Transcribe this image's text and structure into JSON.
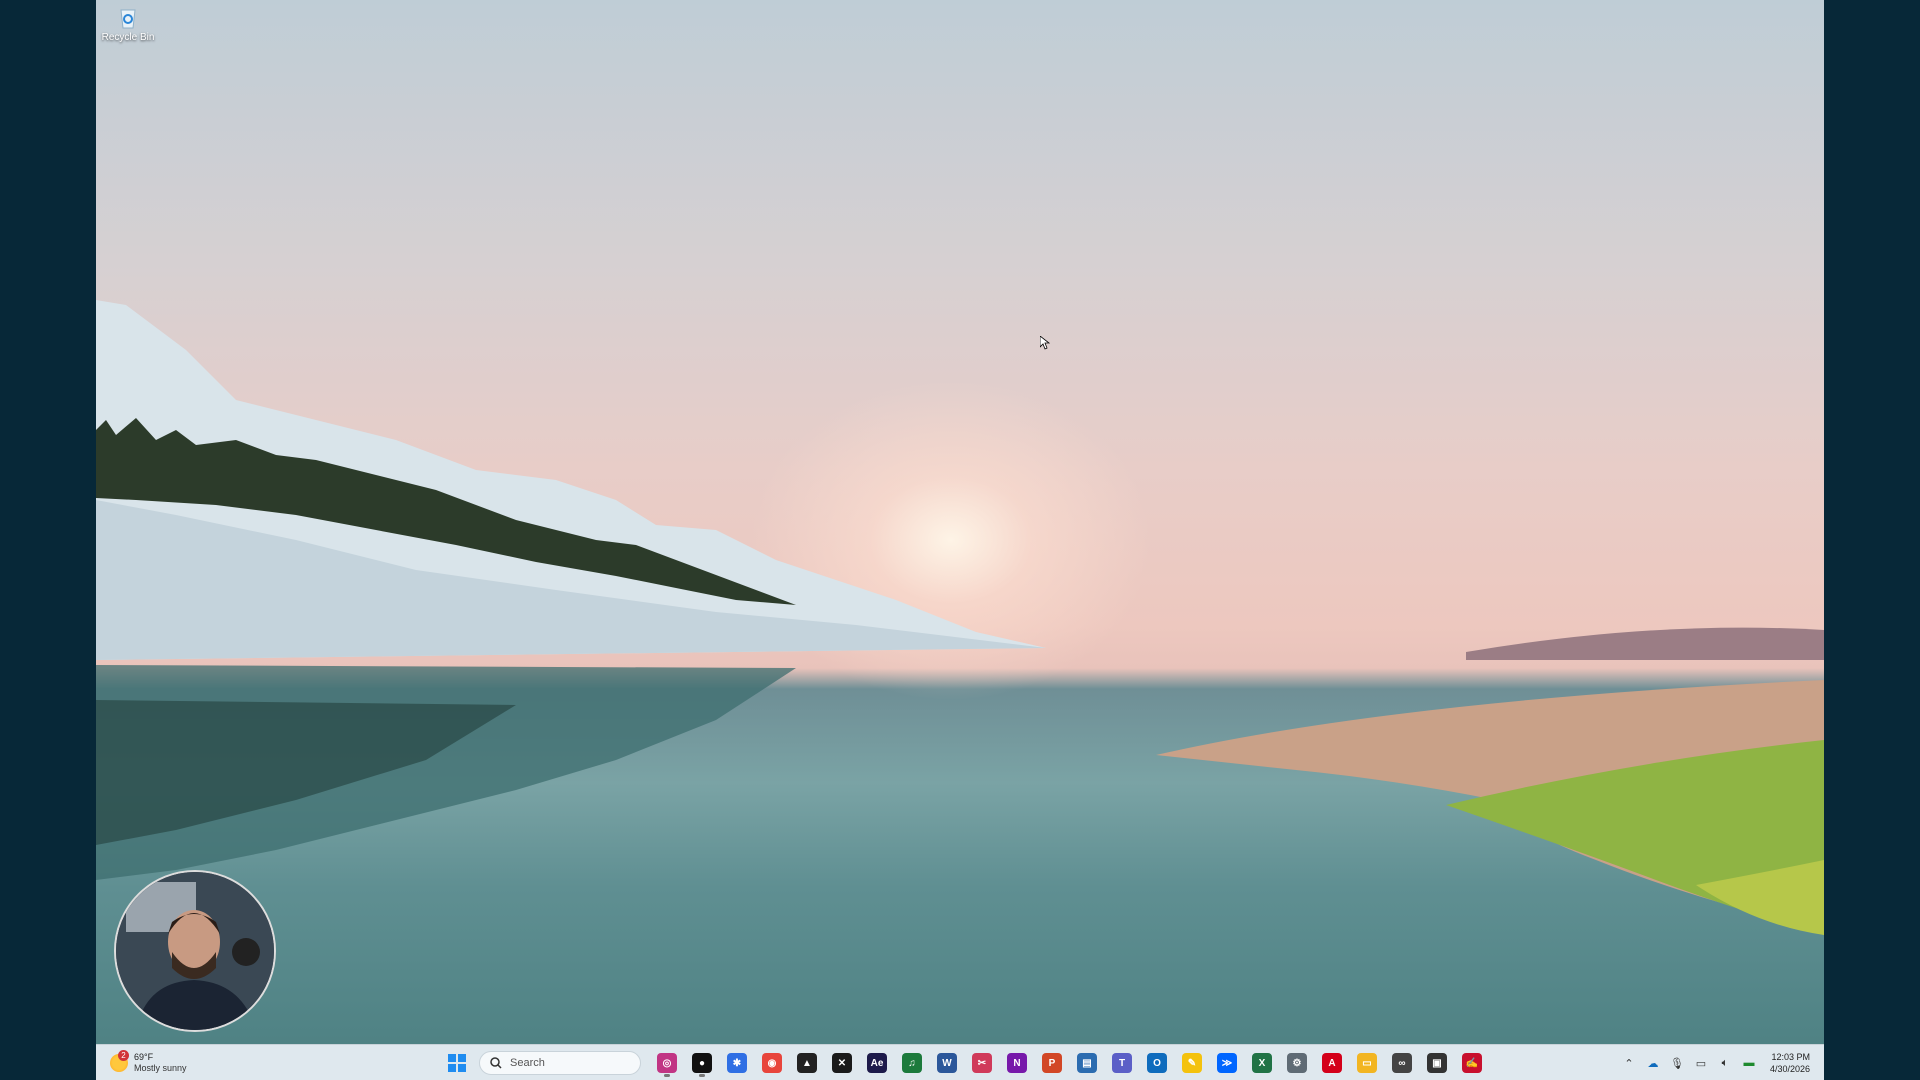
{
  "desktop": {
    "icons": [
      {
        "label": "Recycle Bin",
        "icon": "recycle-bin-icon"
      }
    ]
  },
  "taskbar": {
    "weather": {
      "badge": "2",
      "temperature": "69°F",
      "condition": "Mostly sunny"
    },
    "search": {
      "placeholder": "Search"
    },
    "start_icon": "windows-start-icon",
    "apps": [
      {
        "name": "instagram-icon",
        "color": "#c13584",
        "glyph": "◎",
        "running": true
      },
      {
        "name": "spotify-icon",
        "color": "#111111",
        "glyph": "●",
        "running": true
      },
      {
        "name": "settings-gear-blue-icon",
        "color": "#2f6fe4",
        "glyph": "✱",
        "running": false
      },
      {
        "name": "chrome-icon",
        "color": "#e8453c",
        "glyph": "◉",
        "running": false
      },
      {
        "name": "capcut-icon",
        "color": "#222222",
        "glyph": "▲",
        "running": false
      },
      {
        "name": "xbox-app-icon",
        "color": "#1a1a1a",
        "glyph": "✕",
        "running": false
      },
      {
        "name": "after-effects-icon",
        "color": "#1d1a4a",
        "glyph": "Ae",
        "running": false
      },
      {
        "name": "audio-app-icon",
        "color": "#1c7a3c",
        "glyph": "♫",
        "running": false
      },
      {
        "name": "word-icon",
        "color": "#2b579a",
        "glyph": "W",
        "running": false
      },
      {
        "name": "snipping-tool-icon",
        "color": "#d03a5a",
        "glyph": "✂",
        "running": false
      },
      {
        "name": "onenote-icon",
        "color": "#7719aa",
        "glyph": "N",
        "running": false
      },
      {
        "name": "powerpoint-icon",
        "color": "#d24726",
        "glyph": "P",
        "running": false
      },
      {
        "name": "task-manager-icon",
        "color": "#2b6cb0",
        "glyph": "▤",
        "running": false
      },
      {
        "name": "teams-icon",
        "color": "#5b5fc7",
        "glyph": "T",
        "running": false
      },
      {
        "name": "outlook-icon",
        "color": "#0f6cbd",
        "glyph": "O",
        "running": false
      },
      {
        "name": "sticky-notes-icon",
        "color": "#f4c20d",
        "glyph": "✎",
        "running": false
      },
      {
        "name": "power-automate-icon",
        "color": "#0066ff",
        "glyph": "≫",
        "running": false
      },
      {
        "name": "excel-icon",
        "color": "#217346",
        "glyph": "X",
        "running": false
      },
      {
        "name": "settings-icon",
        "color": "#5f6b75",
        "glyph": "⚙",
        "running": false
      },
      {
        "name": "acrobat-icon",
        "color": "#d4001a",
        "glyph": "A",
        "running": false
      },
      {
        "name": "file-explorer-icon",
        "color": "#f2b522",
        "glyph": "▭",
        "running": false
      },
      {
        "name": "link-tool-icon",
        "color": "#444444",
        "glyph": "∞",
        "running": false
      },
      {
        "name": "image-viewer-icon",
        "color": "#333333",
        "glyph": "▣",
        "running": false
      },
      {
        "name": "acrobat-sign-icon",
        "color": "#c8102e",
        "glyph": "✍",
        "running": false
      }
    ],
    "tray": {
      "icons": [
        "chevron-up-icon",
        "onedrive-icon",
        "microphone-icon",
        "network-icon",
        "volume-icon",
        "battery-icon"
      ],
      "time": "12:03 PM",
      "date": "4/30/2026"
    }
  }
}
